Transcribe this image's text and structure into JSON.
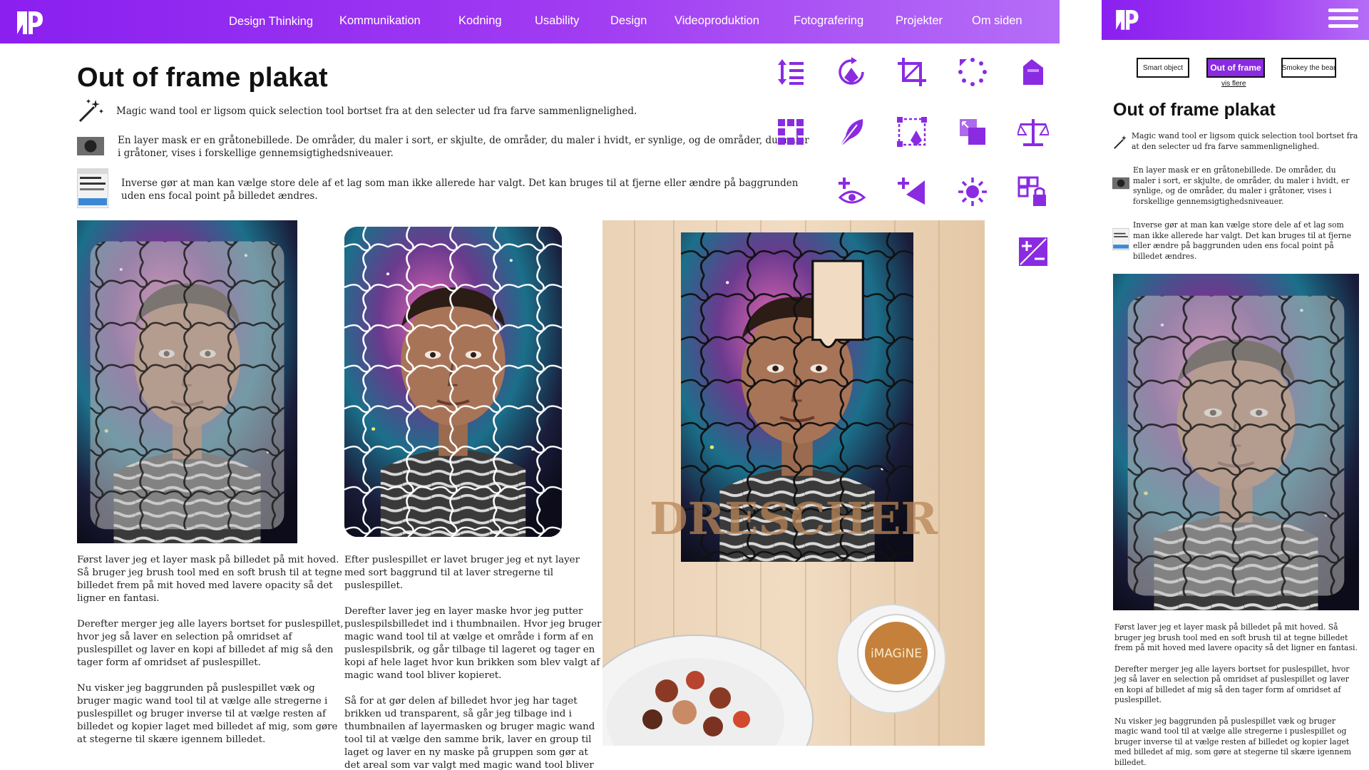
{
  "nav": {
    "links": [
      "Design Thinking",
      "Kommunikation",
      "Kodning",
      "Usability",
      "Design",
      "Videoproduktion",
      "Fotografering",
      "Projekter",
      "Om siden"
    ]
  },
  "article": {
    "title": "Out of frame plakat",
    "tools": [
      {
        "icon": "magic-wand-icon",
        "text": "Magic wand tool er ligsom quick selection tool bortset fra at den selecter ud fra farve sammenlignelighed."
      },
      {
        "icon": "layer-mask-icon",
        "text": "En layer mask er en gråtonebillede. De områder, du maler i sort, er skjulte, de områder, du maler i hvidt, er synlige, og de områder, du maler i gråtoner, vises i forskellige gennemsigtighedsniveauer."
      },
      {
        "icon": "select-menu-icon",
        "text": "Inverse gør at man kan vælge store dele af et lag som man ikke allerede har valgt. Det kan bruges til at fjerne eller ændre på baggrunden uden ens focal point på billedet  ændres."
      }
    ],
    "columns": [
      [
        "Først laver jeg et layer mask på billedet på mit hoved. Så bruger jeg brush tool med en soft brush til at tegne billedet frem på mit hoved med lavere opacity så det ligner en fantasi.",
        "Derefter merger jeg alle layers bortset for puslespillet, hvor jeg så laver en selection på omridset af puslespillet og laver en kopi af billedet af mig så den tager form af omridset af puslespillet.",
        "Nu visker jeg baggrunden på puslespillet væk og bruger magic wand tool til at vælge alle stregerne i puslespillet og bruger inverse til at vælge resten af  billedet og kopier laget med billedet af mig, som gøre at stegerne til skære igennem billedet."
      ],
      [
        "Efter puslespillet er lavet bruger jeg et nyt layer med sort baggrund til at laver stregerne til puslespillet.",
        "Derefter laver jeg en layer maske hvor jeg putter puslespilsbilledet ind i thumbnailen. Hvor jeg bruger magic wand tool til at vælge et område i form af en puslespilsbrik, og går tilbage til lageret og tager en kopi af hele laget hvor kun  brikken som blev valgt af magic wand tool bliver kopieret.",
        "Så for at gør delen af billedet hvor jeg har taget brikken ud transparent,  så går jeg tilbage ind i thumbnailen af layermasken og bruger magic wand tool til at vælge den samme brik, laver en group til laget og laver en ny maske på gruppen som gør at det areal som var valgt med magic wand tool bliver usynligt."
      ]
    ],
    "poster_text": "DRESCHER",
    "cup_text": "iMAGiNE"
  },
  "icon_grid": [
    "line-height-icon",
    "pen-rotate-icon",
    "crop-icon",
    "rotate-dots-icon",
    "bucket-icon",
    "grid-icon",
    "feather-pen-icon",
    "anchor-points-icon",
    "layers-icon",
    "balance-icon",
    "add-eye-icon",
    "add-arrow-icon",
    "brightness-icon",
    "lock-grid-icon",
    "plus-minus-icon"
  ],
  "mobile": {
    "buttons": [
      "Smart object",
      "Out of frame",
      "Smokey the bear"
    ],
    "more_link": "vis flere",
    "title": "Out of frame plakat",
    "paragraphs": [
      "Først laver jeg et layer mask på billedet på mit hoved. Så bruger jeg brush tool med en soft brush til at tegne billedet frem på mit hoved med lavere opacity så det ligner en fantasi.",
      "Derefter merger jeg alle layers bortset for puslespillet, hvor jeg så laver en selection på omridset af puslespillet og laver en kopi af billedet af mig så den tager form af omridset af puslespillet.",
      "Nu visker jeg baggrunden på puslespillet væk og bruger magic wand tool til at vælge alle stregerne i puslespillet og bruger inverse til at vælge resten af  billedet og kopier laget med billedet af mig, som gøre at stegerne til skære igennem billedet."
    ]
  },
  "colors": {
    "accent": "#8a1ff0",
    "accent_light": "#b56df7",
    "icon": "#8a2be2"
  }
}
